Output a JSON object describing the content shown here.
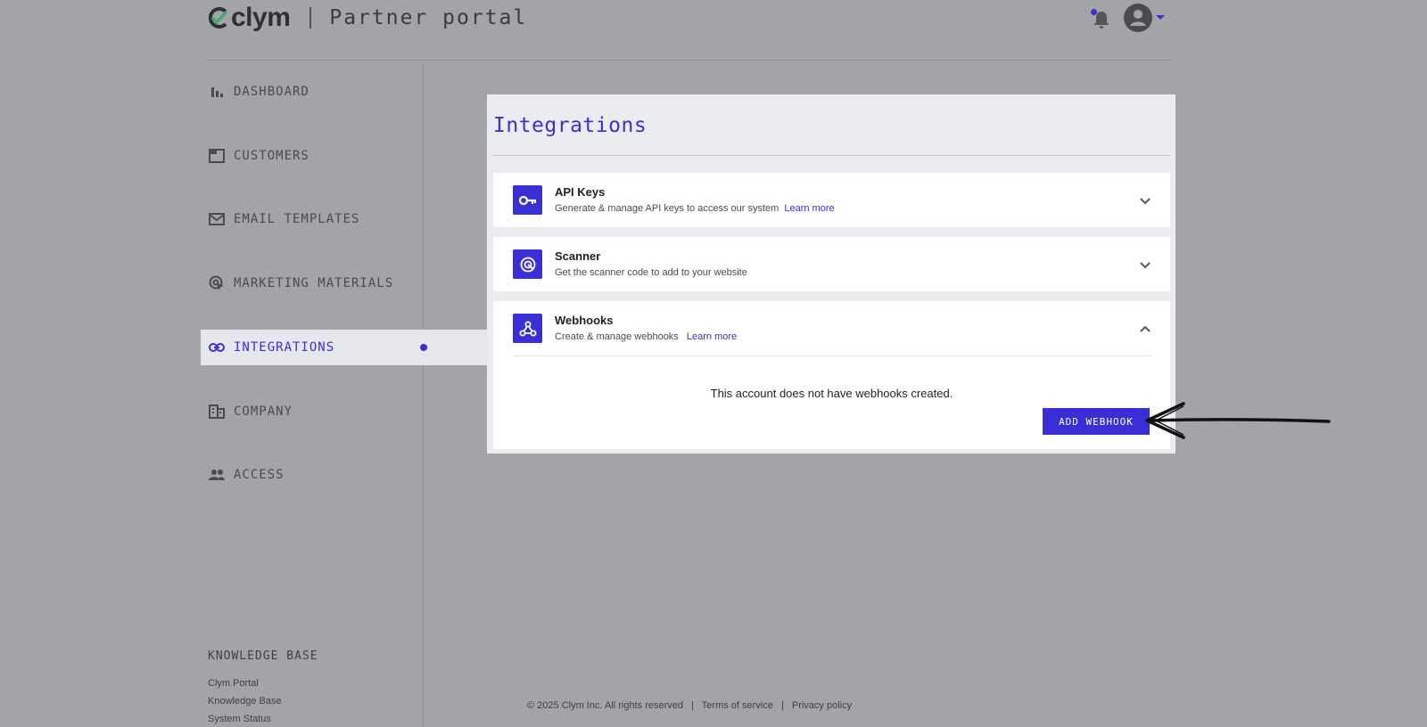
{
  "header": {
    "logo_text": "clym",
    "portal_title": "Partner portal",
    "icons": {
      "bell": "bell-icon",
      "avatar": "account-icon",
      "caret": "caret-down-icon"
    }
  },
  "sidebar": {
    "items": [
      {
        "label": "DASHBOARD",
        "icon": "bar-chart-icon",
        "active": false
      },
      {
        "label": "CUSTOMERS",
        "icon": "window-icon",
        "active": false
      },
      {
        "label": "EMAIL TEMPLATES",
        "icon": "mail-icon",
        "active": false
      },
      {
        "label": "MARKETING MATERIALS",
        "icon": "target-cursor-icon",
        "active": false
      },
      {
        "label": "INTEGRATIONS",
        "icon": "link-icon",
        "active": true
      },
      {
        "label": "COMPANY",
        "icon": "building-icon",
        "active": false
      },
      {
        "label": "ACCESS",
        "icon": "people-icon",
        "active": false
      }
    ],
    "knowledge_base": {
      "title": "KNOWLEDGE BASE",
      "links": [
        "Clym Portal",
        "Knowledge Base",
        "System Status"
      ]
    }
  },
  "main": {
    "title": "Integrations",
    "cards": [
      {
        "title": "API Keys",
        "description": "Generate & manage API keys to access our system",
        "link": "Learn more",
        "icon": "key-icon",
        "expanded": false
      },
      {
        "title": "Scanner",
        "description": "Get the scanner code to add to your website",
        "link": "",
        "icon": "scan-icon",
        "expanded": false
      },
      {
        "title": "Webhooks",
        "description": "Create & manage webhooks",
        "link": "Learn more",
        "icon": "webhook-icon",
        "expanded": true
      }
    ],
    "webhooks": {
      "empty_message": "This account does not have webhooks created.",
      "add_button": "ADD WEBHOOK"
    }
  },
  "footer": {
    "copyright": "© 2025 Clym Inc. All rights reserved",
    "separator": "|",
    "terms": "Terms of service",
    "privacy": "Privacy policy"
  },
  "colors": {
    "accent": "#3a2fd6",
    "overlay_background": "#a3a4a8",
    "panel_background": "#ebecf0",
    "card_background": "#ffffff"
  }
}
